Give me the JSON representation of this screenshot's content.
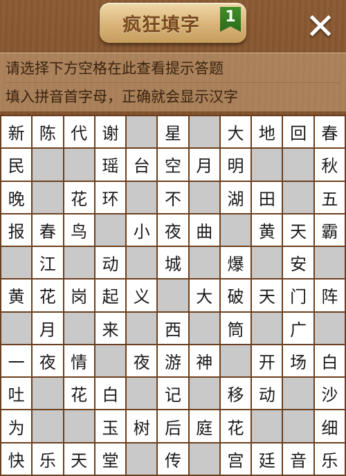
{
  "header": {
    "title": "疯狂填字",
    "level": "1",
    "close_label": "✕"
  },
  "hints": {
    "line1": "请选择下方空格在此查看提示答题",
    "line2": "填入拼音首字母，正确就会显示汉字"
  },
  "grid": [
    [
      "新",
      "陈",
      "代",
      "谢",
      "",
      "星",
      "",
      "大",
      "地",
      "回",
      "春"
    ],
    [
      "民",
      "",
      "",
      "瑶",
      "台",
      "空",
      "月",
      "明",
      "",
      "",
      "秋"
    ],
    [
      "晚",
      "",
      "花",
      "环",
      "",
      "不",
      "",
      "湖",
      "田",
      "",
      "五"
    ],
    [
      "报",
      "春",
      "鸟",
      "",
      "小",
      "夜",
      "曲",
      "",
      "黄",
      "天",
      "霸"
    ],
    [
      "",
      "江",
      "",
      "动",
      "",
      "城",
      "",
      "爆",
      "",
      "安",
      ""
    ],
    [
      "黄",
      "花",
      "岗",
      "起",
      "义",
      "",
      "大",
      "破",
      "天",
      "门",
      "阵"
    ],
    [
      "",
      "月",
      "",
      "来",
      "",
      "西",
      "",
      "筒",
      "",
      "广",
      ""
    ],
    [
      "一",
      "夜",
      "情",
      "",
      "夜",
      "游",
      "神",
      "",
      "开",
      "场",
      "白"
    ],
    [
      "吐",
      "",
      "花",
      "白",
      "",
      "记",
      "",
      "移",
      "动",
      "",
      "沙"
    ],
    [
      "为",
      "",
      "",
      "玉",
      "树",
      "后",
      "庭",
      "花",
      "",
      "",
      "细"
    ],
    [
      "快",
      "乐",
      "天",
      "堂",
      "",
      "传",
      "",
      "宫",
      "廷",
      "音",
      "乐"
    ]
  ]
}
